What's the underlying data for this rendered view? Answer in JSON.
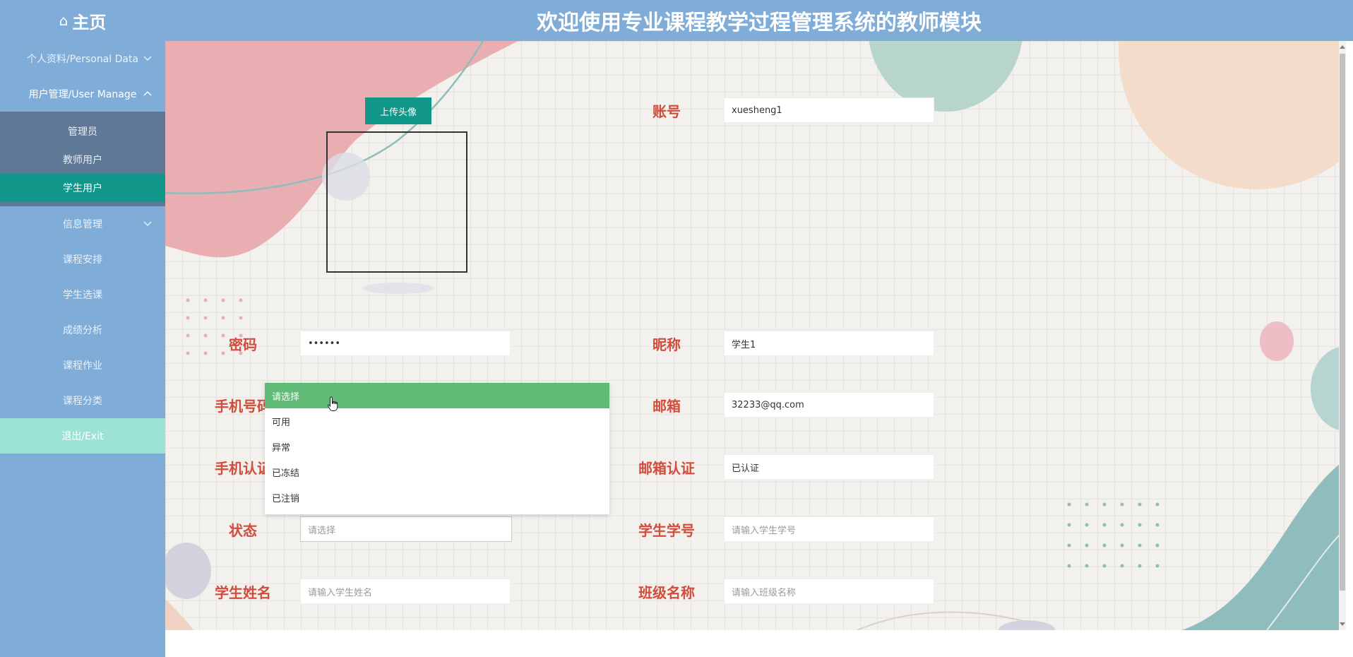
{
  "header": {
    "home_icon": "home-icon",
    "home_label": "主页",
    "title": "欢迎使用专业课程教学过程管理系统的教师模块"
  },
  "sidebar": {
    "items": [
      {
        "label": "个人资料/Personal Data",
        "expandable": true
      },
      {
        "label": "用户管理/User Manage",
        "expandable": true,
        "expanded": true,
        "children": [
          "管理员",
          "教师用户",
          "学生用户"
        ],
        "active_child": "学生用户"
      },
      {
        "label": "信息管理",
        "expandable": true
      },
      {
        "label": "课程安排"
      },
      {
        "label": "学生选课"
      },
      {
        "label": "成绩分析"
      },
      {
        "label": "课程作业"
      },
      {
        "label": "课程分类"
      },
      {
        "label": "退出/Exit"
      }
    ]
  },
  "form": {
    "upload_button": "上传头像",
    "account_label": "账号",
    "account_value": "xuesheng1",
    "password_label": "密码",
    "password_value": "••••••",
    "nickname_label": "昵称",
    "nickname_value": "学生1",
    "phone_label": "手机号码",
    "email_label": "邮箱",
    "email_value": "32233@qq.com",
    "phone_verify_label": "手机认证",
    "email_verify_label": "邮箱认证",
    "email_verify_value": "已认证",
    "status_label": "状态",
    "status_placeholder": "请选择",
    "student_id_label": "学生学号",
    "student_id_placeholder": "请输入学生学号",
    "student_name_label": "学生姓名",
    "student_name_placeholder": "请输入学生姓名",
    "class_name_label": "班级名称",
    "class_name_placeholder": "请输入班级名称"
  },
  "status_dropdown": {
    "options": [
      "请选择",
      "可用",
      "异常",
      "已冻结",
      "已注销"
    ],
    "selected": "请选择"
  },
  "colors": {
    "header_bg": "#80acd8",
    "accent_teal": "#11978a",
    "label_red": "#d24c3c",
    "option_selected": "#5fbb76"
  }
}
